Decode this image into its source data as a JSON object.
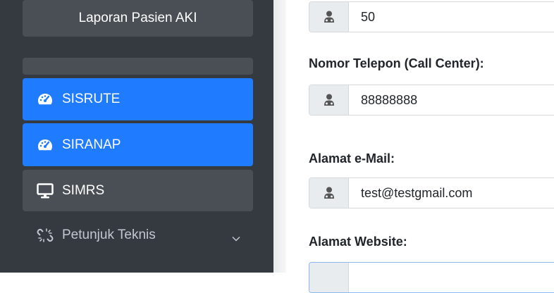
{
  "sidebar": {
    "report_label": "Laporan Pasien AKI",
    "items": [
      {
        "label": "SISRUTE",
        "icon": "tachometer-icon",
        "active": true
      },
      {
        "label": "SIRANAP",
        "icon": "tachometer-icon",
        "active": true
      },
      {
        "label": "SIMRS",
        "icon": "monitor-icon",
        "active": false
      }
    ],
    "juknis": {
      "label": "Petunjuk Teknis",
      "icon": "broken-link-icon"
    }
  },
  "form": {
    "field_top": {
      "value": "50"
    },
    "phone": {
      "label": "Nomor Telepon (Call Center):",
      "value": "88888888"
    },
    "email": {
      "label": "Alamat e-Mail:",
      "value": "test@testgmail.com"
    },
    "website": {
      "label": "Alamat Website:",
      "value": ""
    }
  },
  "colors": {
    "sidebar_bg": "#343a40",
    "active_bg": "#1f7bff",
    "button_bg": "#4a4f55"
  }
}
